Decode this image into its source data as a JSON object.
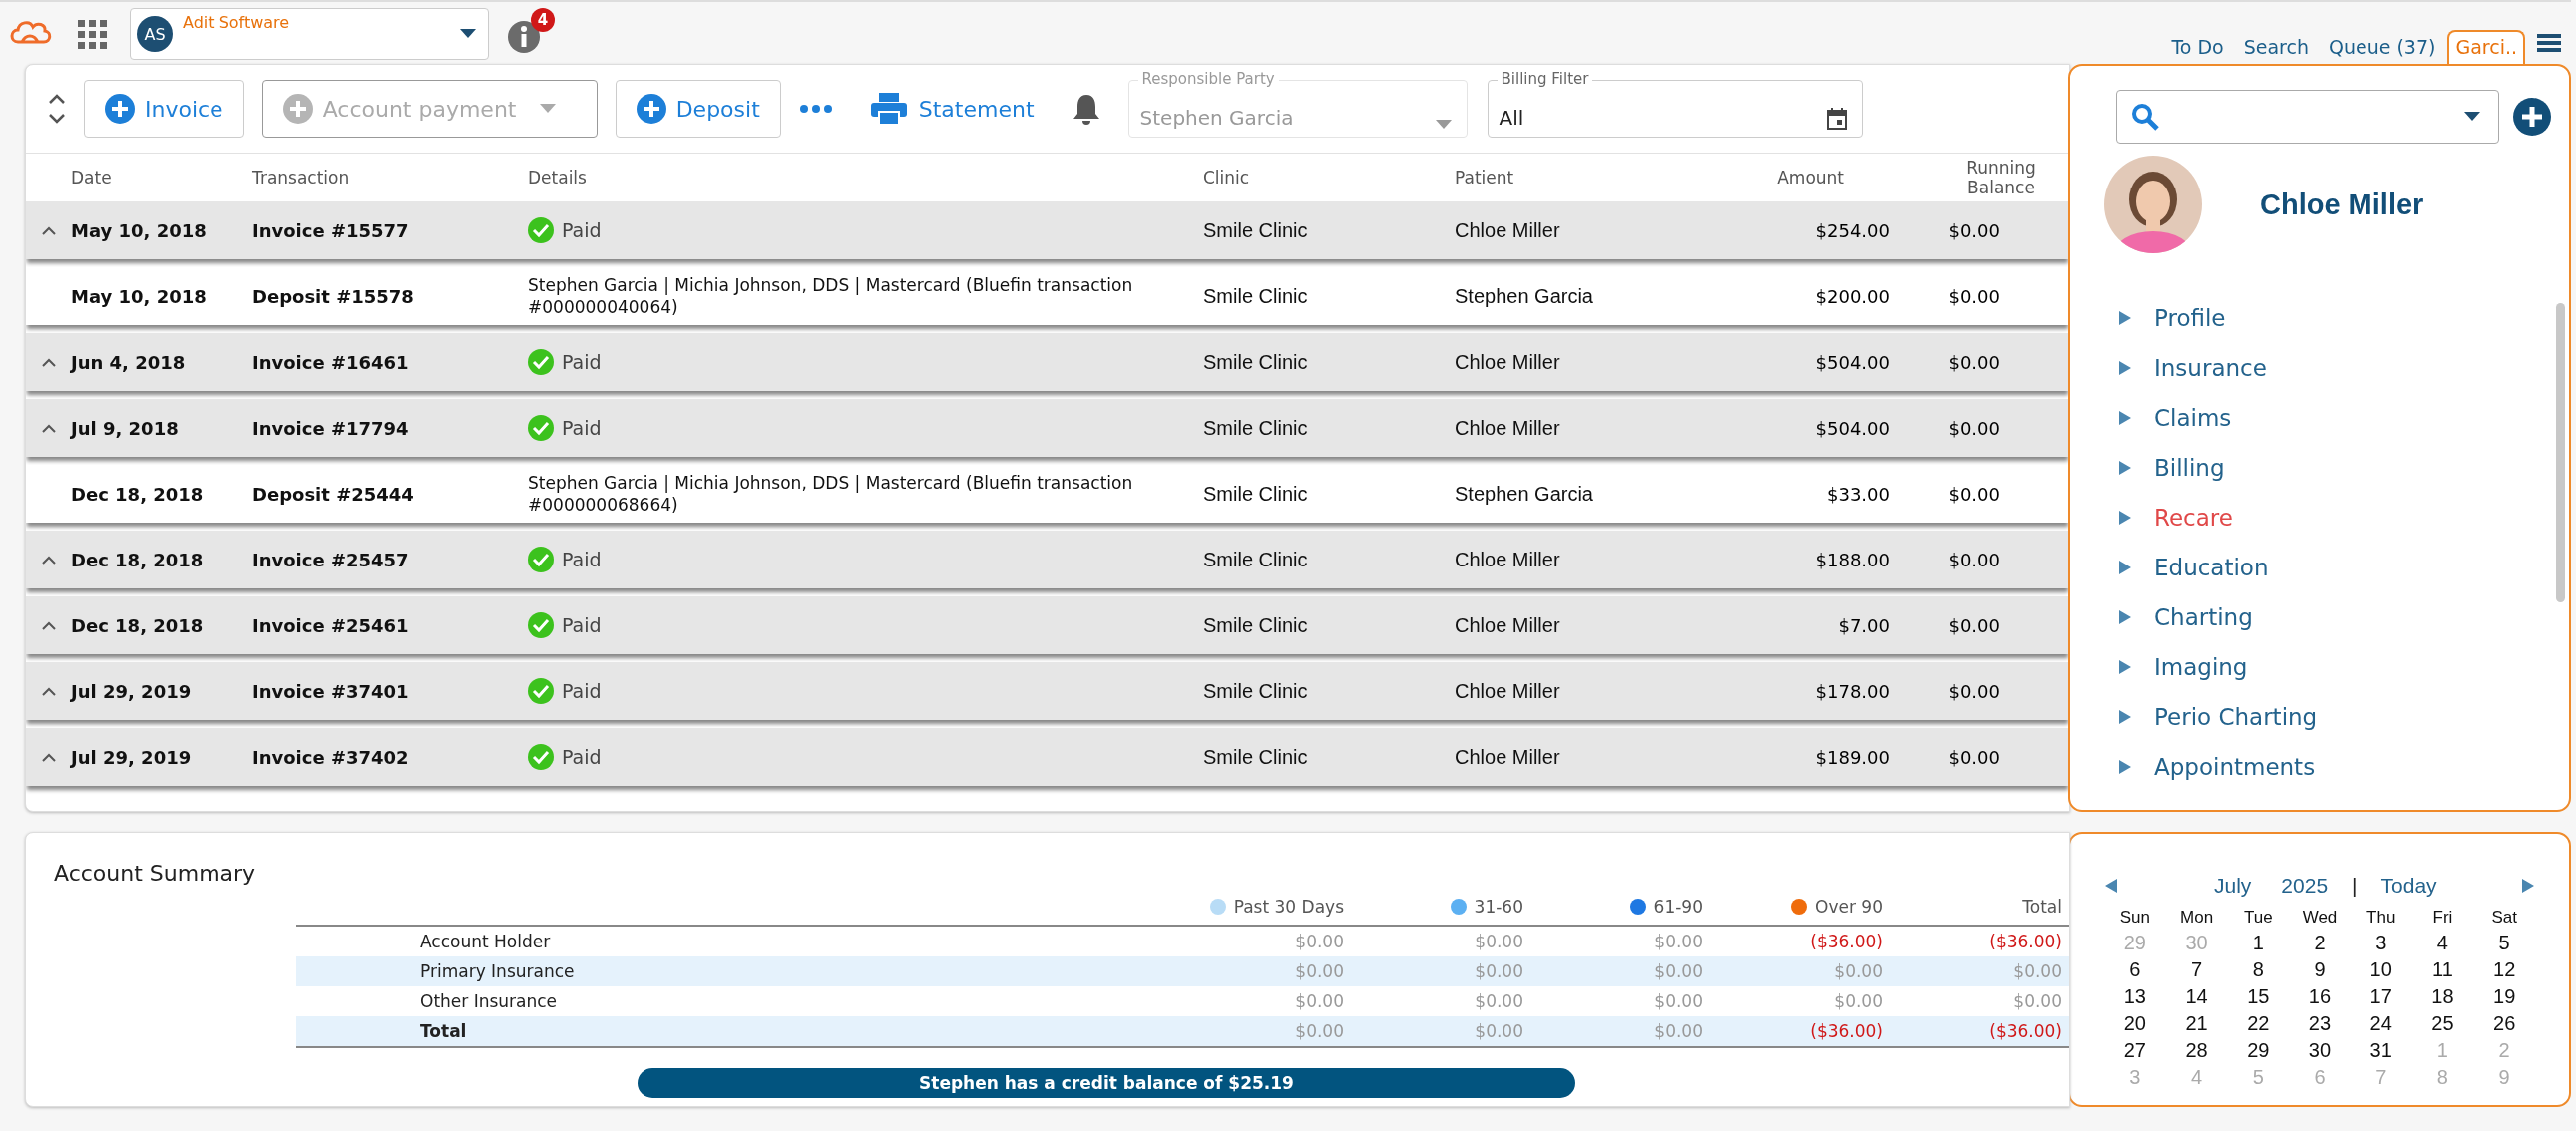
{
  "topbar": {
    "initials": "AS",
    "brand": "Adit Software",
    "notification_count": "4"
  },
  "tabs": [
    {
      "label": "To Do",
      "selected": false
    },
    {
      "label": "Search",
      "selected": false
    },
    {
      "label": "Queue (37)",
      "selected": false
    },
    {
      "label": "Garci..",
      "selected": true
    }
  ],
  "toolbar": {
    "buttons": [
      {
        "label": "Invoice",
        "kind": "add",
        "disabled": false
      },
      {
        "label": "Account payment",
        "kind": "add-dropdown",
        "disabled": true
      },
      {
        "label": "Deposit",
        "kind": "add",
        "disabled": false
      }
    ],
    "statement": "Statement",
    "responsible_party": {
      "label": "Responsible Party",
      "value": "Stephen Garcia",
      "disabled": true
    },
    "billing_filter": {
      "label": "Billing Filter",
      "value": "All",
      "disabled": false
    }
  },
  "ledger": {
    "columns": [
      "Date",
      "Transaction",
      "Details",
      "Clinic",
      "Patient",
      "Amount",
      "Running Balance"
    ],
    "rows": [
      {
        "kind": "invoice",
        "date": "May 10, 2018",
        "transaction": "Invoice #15577",
        "details": "Paid",
        "clinic": "Smile Clinic",
        "patient": "Chloe Miller",
        "amount": "$254.00",
        "balance": "$0.00"
      },
      {
        "kind": "deposit",
        "date": "May 10, 2018",
        "transaction": "Deposit #15578",
        "details": "Stephen Garcia | Michia Johnson, DDS | Mastercard (Bluefin transaction #000000040064)",
        "clinic": "Smile Clinic",
        "patient": "Stephen Garcia",
        "amount": "$200.00",
        "balance": "$0.00"
      },
      {
        "kind": "invoice",
        "date": "Jun 4, 2018",
        "transaction": "Invoice #16461",
        "details": "Paid",
        "clinic": "Smile Clinic",
        "patient": "Chloe Miller",
        "amount": "$504.00",
        "balance": "$0.00"
      },
      {
        "kind": "invoice",
        "date": "Jul 9, 2018",
        "transaction": "Invoice #17794",
        "details": "Paid",
        "clinic": "Smile Clinic",
        "patient": "Chloe Miller",
        "amount": "$504.00",
        "balance": "$0.00"
      },
      {
        "kind": "deposit",
        "date": "Dec 18, 2018",
        "transaction": "Deposit #25444",
        "details": "Stephen Garcia | Michia Johnson, DDS | Mastercard (Bluefin transaction #000000068664)",
        "clinic": "Smile Clinic",
        "patient": "Stephen Garcia",
        "amount": "$33.00",
        "balance": "$0.00"
      },
      {
        "kind": "invoice",
        "date": "Dec 18, 2018",
        "transaction": "Invoice #25457",
        "details": "Paid",
        "clinic": "Smile Clinic",
        "patient": "Chloe Miller",
        "amount": "$188.00",
        "balance": "$0.00"
      },
      {
        "kind": "invoice",
        "date": "Dec 18, 2018",
        "transaction": "Invoice #25461",
        "details": "Paid",
        "clinic": "Smile Clinic",
        "patient": "Chloe Miller",
        "amount": "$7.00",
        "balance": "$0.00"
      },
      {
        "kind": "invoice",
        "date": "Jul 29, 2019",
        "transaction": "Invoice #37401",
        "details": "Paid",
        "clinic": "Smile Clinic",
        "patient": "Chloe Miller",
        "amount": "$178.00",
        "balance": "$0.00"
      },
      {
        "kind": "invoice",
        "date": "Jul 29, 2019",
        "transaction": "Invoice #37402",
        "details": "Paid",
        "clinic": "Smile Clinic",
        "patient": "Chloe Miller",
        "amount": "$189.00",
        "balance": "$0.00"
      }
    ]
  },
  "patient": {
    "name": "Chloe Miller",
    "menu": [
      {
        "label": "Profile",
        "alert": false
      },
      {
        "label": "Insurance",
        "alert": false
      },
      {
        "label": "Claims",
        "alert": false
      },
      {
        "label": "Billing",
        "alert": false
      },
      {
        "label": "Recare",
        "alert": true
      },
      {
        "label": "Education",
        "alert": false
      },
      {
        "label": "Charting",
        "alert": false
      },
      {
        "label": "Imaging",
        "alert": false
      },
      {
        "label": "Perio Charting",
        "alert": false
      },
      {
        "label": "Appointments",
        "alert": false
      }
    ]
  },
  "summary": {
    "title": "Account Summary",
    "columns": [
      {
        "label": "Past 30 Days",
        "color": "#b8dcf6"
      },
      {
        "label": "31-60",
        "color": "#5cb0f2"
      },
      {
        "label": "61-90",
        "color": "#1e78e2"
      },
      {
        "label": "Over 90",
        "color": "#ef6c0c"
      },
      {
        "label": "Total"
      }
    ],
    "rows": [
      {
        "label": "Account Holder",
        "total": false,
        "values": [
          {
            "text": "$0.00",
            "negative": false
          },
          {
            "text": "$0.00",
            "negative": false
          },
          {
            "text": "$0.00",
            "negative": false
          },
          {
            "text": "($36.00)",
            "negative": true
          },
          {
            "text": "($36.00)",
            "negative": true
          }
        ]
      },
      {
        "label": "Primary Insurance",
        "total": false,
        "values": [
          {
            "text": "$0.00",
            "negative": false
          },
          {
            "text": "$0.00",
            "negative": false
          },
          {
            "text": "$0.00",
            "negative": false
          },
          {
            "text": "$0.00",
            "negative": false
          },
          {
            "text": "$0.00",
            "negative": false
          }
        ]
      },
      {
        "label": "Other Insurance",
        "total": false,
        "values": [
          {
            "text": "$0.00",
            "negative": false
          },
          {
            "text": "$0.00",
            "negative": false
          },
          {
            "text": "$0.00",
            "negative": false
          },
          {
            "text": "$0.00",
            "negative": false
          },
          {
            "text": "$0.00",
            "negative": false
          }
        ]
      },
      {
        "label": "Total",
        "total": true,
        "values": [
          {
            "text": "$0.00",
            "negative": false
          },
          {
            "text": "$0.00",
            "negative": false
          },
          {
            "text": "$0.00",
            "negative": false
          },
          {
            "text": "($36.00)",
            "negative": true
          },
          {
            "text": "($36.00)",
            "negative": true
          }
        ]
      }
    ],
    "message": "Stephen has a credit balance of $25.19"
  },
  "calendar": {
    "month": "July",
    "year": "2025",
    "separator": "|",
    "today": "Today",
    "weekdays": [
      "Sun",
      "Mon",
      "Tue",
      "Wed",
      "Thu",
      "Fri",
      "Sat"
    ],
    "weeks": [
      [
        {
          "day": "29",
          "other_month": true
        },
        {
          "day": "30",
          "other_month": true
        },
        {
          "day": "1",
          "other_month": false
        },
        {
          "day": "2",
          "other_month": false
        },
        {
          "day": "3",
          "other_month": false
        },
        {
          "day": "4",
          "other_month": false
        },
        {
          "day": "5",
          "other_month": false
        }
      ],
      [
        {
          "day": "6",
          "other_month": false
        },
        {
          "day": "7",
          "other_month": false
        },
        {
          "day": "8",
          "other_month": false
        },
        {
          "day": "9",
          "other_month": false
        },
        {
          "day": "10",
          "other_month": false
        },
        {
          "day": "11",
          "other_month": false
        },
        {
          "day": "12",
          "other_month": false
        }
      ],
      [
        {
          "day": "13",
          "other_month": false
        },
        {
          "day": "14",
          "other_month": false
        },
        {
          "day": "15",
          "other_month": false
        },
        {
          "day": "16",
          "other_month": false
        },
        {
          "day": "17",
          "other_month": false
        },
        {
          "day": "18",
          "other_month": false
        },
        {
          "day": "19",
          "other_month": false
        }
      ],
      [
        {
          "day": "20",
          "other_month": false
        },
        {
          "day": "21",
          "other_month": false
        },
        {
          "day": "22",
          "other_month": false
        },
        {
          "day": "23",
          "other_month": false
        },
        {
          "day": "24",
          "other_month": false
        },
        {
          "day": "25",
          "other_month": false
        },
        {
          "day": "26",
          "other_month": false
        }
      ],
      [
        {
          "day": "27",
          "other_month": false
        },
        {
          "day": "28",
          "other_month": false
        },
        {
          "day": "29",
          "other_month": false
        },
        {
          "day": "30",
          "other_month": false
        },
        {
          "day": "31",
          "other_month": false
        },
        {
          "day": "1",
          "other_month": true
        },
        {
          "day": "2",
          "other_month": true
        }
      ],
      [
        {
          "day": "3",
          "other_month": true
        },
        {
          "day": "4",
          "other_month": true
        },
        {
          "day": "5",
          "other_month": true
        },
        {
          "day": "6",
          "other_month": true
        },
        {
          "day": "7",
          "other_month": true
        },
        {
          "day": "8",
          "other_month": true
        },
        {
          "day": "9",
          "other_month": true
        }
      ]
    ]
  }
}
